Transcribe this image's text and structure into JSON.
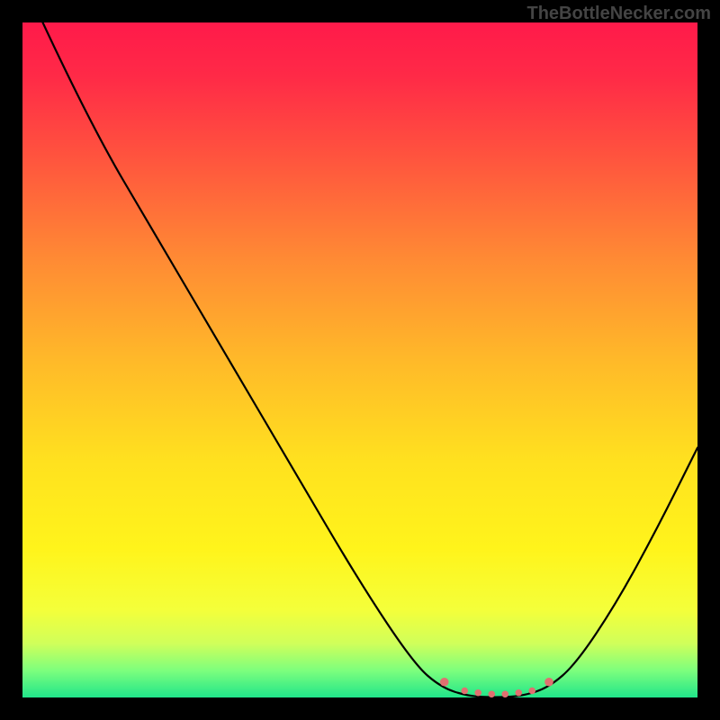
{
  "attribution": "TheBottleNecker.com",
  "chart_data": {
    "type": "line",
    "title": "",
    "xlabel": "",
    "ylabel": "",
    "xlim": [
      0,
      100
    ],
    "ylim": [
      0,
      100
    ],
    "background_gradient": {
      "stops": [
        {
          "offset": 0.0,
          "color": "#ff1a4a"
        },
        {
          "offset": 0.08,
          "color": "#ff2a47"
        },
        {
          "offset": 0.2,
          "color": "#ff543e"
        },
        {
          "offset": 0.35,
          "color": "#ff8a34"
        },
        {
          "offset": 0.5,
          "color": "#ffb929"
        },
        {
          "offset": 0.65,
          "color": "#ffe11f"
        },
        {
          "offset": 0.78,
          "color": "#fff41b"
        },
        {
          "offset": 0.87,
          "color": "#f4ff3a"
        },
        {
          "offset": 0.92,
          "color": "#d0ff5a"
        },
        {
          "offset": 0.96,
          "color": "#7dff7d"
        },
        {
          "offset": 1.0,
          "color": "#20e58a"
        }
      ]
    },
    "series": [
      {
        "name": "bottleneck-curve",
        "color": "#000000",
        "width": 2.2,
        "points": [
          {
            "x": 3,
            "y": 100
          },
          {
            "x": 10,
            "y": 85
          },
          {
            "x": 20,
            "y": 68
          },
          {
            "x": 30,
            "y": 51
          },
          {
            "x": 40,
            "y": 34
          },
          {
            "x": 50,
            "y": 17
          },
          {
            "x": 58,
            "y": 5
          },
          {
            "x": 62,
            "y": 1.5
          },
          {
            "x": 66,
            "y": 0.2
          },
          {
            "x": 70,
            "y": 0.0
          },
          {
            "x": 74,
            "y": 0.2
          },
          {
            "x": 78,
            "y": 1.5
          },
          {
            "x": 82,
            "y": 5
          },
          {
            "x": 88,
            "y": 14
          },
          {
            "x": 94,
            "y": 25
          },
          {
            "x": 100,
            "y": 37
          }
        ]
      }
    ],
    "markers": [
      {
        "x": 62.5,
        "y": 2.3,
        "r": 4.8,
        "color": "#e07070"
      },
      {
        "x": 65.5,
        "y": 1.0,
        "r": 3.8,
        "color": "#e07070"
      },
      {
        "x": 67.5,
        "y": 0.7,
        "r": 3.8,
        "color": "#e07070"
      },
      {
        "x": 69.5,
        "y": 0.5,
        "r": 3.8,
        "color": "#e07070"
      },
      {
        "x": 71.5,
        "y": 0.5,
        "r": 3.8,
        "color": "#e07070"
      },
      {
        "x": 73.5,
        "y": 0.7,
        "r": 3.8,
        "color": "#e07070"
      },
      {
        "x": 75.5,
        "y": 1.0,
        "r": 3.8,
        "color": "#e07070"
      },
      {
        "x": 78.0,
        "y": 2.3,
        "r": 4.8,
        "color": "#e07070"
      }
    ]
  }
}
